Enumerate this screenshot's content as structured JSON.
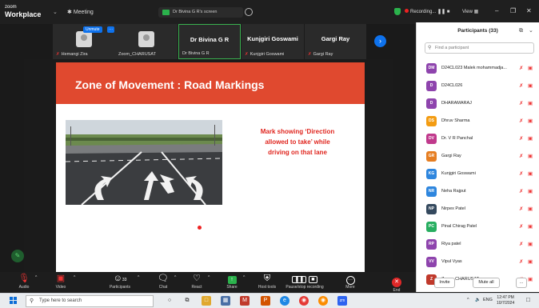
{
  "titlebar": {
    "brand_small": "zoom",
    "brand_big": "Workplace",
    "meeting_label": "Meeting",
    "share_label": "Dr Bivina G R's screen",
    "recording_label": "Recording...",
    "view_label": "View"
  },
  "strip": {
    "unmute_label": "Unmute",
    "tiles": [
      {
        "name": "Hemangi Zira"
      },
      {
        "name": "Zoom_CHARUSAT"
      },
      {
        "big_name": "Dr Bivina G R",
        "name": "Dr Bivina G R"
      },
      {
        "big_name": "Kunjgiri Goswami",
        "name": "Kunjgiri Goswami"
      },
      {
        "big_name": "Gargi Ray",
        "name": "Gargi Ray"
      }
    ]
  },
  "slide": {
    "title": "Zone of Movement : Road Markings",
    "caption_line1": "Mark showing ‘Direction",
    "caption_line2": "allowed to take’ while",
    "caption_line3": "driving on that lane"
  },
  "panel": {
    "title": "Participants (33)",
    "search_placeholder": "Find a participant",
    "participants": [
      {
        "initials": "DM",
        "name": "D24CL023 Malek mohammadja...",
        "color": "#8e44ad"
      },
      {
        "initials": "D",
        "name": "D24CL026",
        "color": "#8e44ad"
      },
      {
        "initials": "D",
        "name": "DHARAMARAJ",
        "color": "#8e44ad"
      },
      {
        "initials": "DS",
        "name": "Dhruv Sharma",
        "color": "#f39c12"
      },
      {
        "initials": "DV",
        "name": "Dr. V R Panchal",
        "color": "#c0398c"
      },
      {
        "initials": "GR",
        "name": "Gargi Ray",
        "color": "#e67e22"
      },
      {
        "initials": "KG",
        "name": "Kunjgiri Goswami",
        "color": "#2e86de"
      },
      {
        "initials": "NR",
        "name": "Neha Rajput",
        "color": "#2e86de"
      },
      {
        "initials": "NP",
        "name": "Nirpex Patel",
        "color": "#34495e"
      },
      {
        "initials": "PC",
        "name": "Pinal Chirag Patel",
        "color": "#27ae60"
      },
      {
        "initials": "RP",
        "name": "Riya patel",
        "color": "#8e44ad"
      },
      {
        "initials": "VV",
        "name": "Vipul Vyas",
        "color": "#8e44ad"
      },
      {
        "initials": "Z",
        "name": "Zoom_CHARUSAT",
        "color": "#c0392b"
      }
    ],
    "invite_label": "Invite",
    "mute_all_label": "Mute all",
    "more_label": "..."
  },
  "toolbar": {
    "audio": "Audio",
    "video": "Video",
    "participants": "Participants",
    "participants_count": "33",
    "chat": "Chat",
    "react": "React",
    "share": "Share",
    "host_tools": "Host tools",
    "pause_recording": "Pause/stop recording",
    "more": "More",
    "end": "End"
  },
  "taskbar": {
    "search_placeholder": "Type here to search",
    "lang": "ENG",
    "time": "12:47 PM",
    "date": "10/7/2024"
  },
  "colors": {
    "zoom_blue": "#0e72ed",
    "slide_header": "#e0492f",
    "slide_text": "#e0261f",
    "rec_red": "#e22222",
    "active_green": "#3ab14f"
  }
}
